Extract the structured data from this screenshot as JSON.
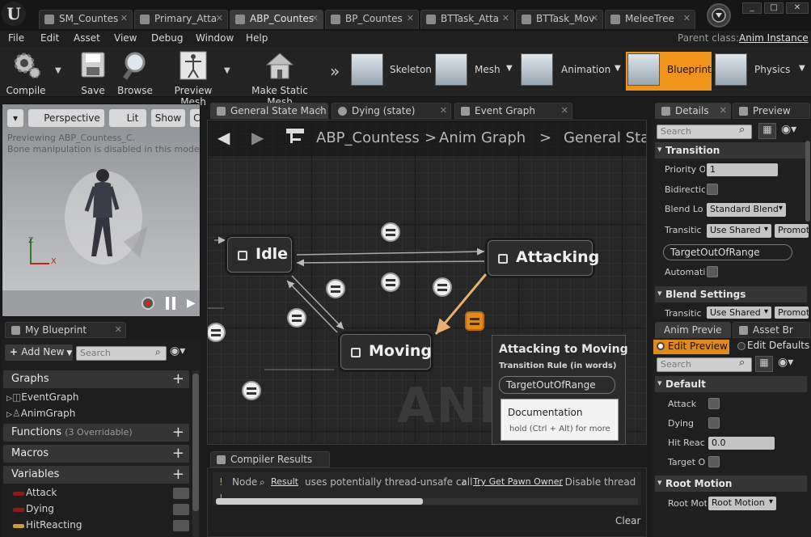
{
  "doc_tabs": [
    {
      "label": "SM_Countes"
    },
    {
      "label": "Primary_Atta"
    },
    {
      "label": "ABP_Countes"
    },
    {
      "label": "BP_Countes"
    },
    {
      "label": "BTTask_Atta"
    },
    {
      "label": "BTTask_Mov"
    },
    {
      "label": "MeleeTree"
    }
  ],
  "menu": [
    "File",
    "Edit",
    "Asset",
    "View",
    "Debug",
    "Window",
    "Help"
  ],
  "parent_class": {
    "label": "Parent class:",
    "value": "Anim Instance"
  },
  "toolbar": {
    "compile": "Compile",
    "save": "Save",
    "browse": "Browse",
    "preview_mesh": "Preview Mesh",
    "make_static_mesh": "Make Static Mesh"
  },
  "modes": {
    "skeleton": "Skeleton",
    "mesh": "Mesh",
    "animation": "Animation",
    "blueprint": "Blueprint",
    "physics": "Physics"
  },
  "viewport": {
    "perspective": "Perspective",
    "lit": "Lit",
    "show": "Show",
    "cl": "Cl",
    "line1": "Previewing ABP_Countess_C.",
    "line2": "Bone manipulation is disabled in this mode.",
    "axis_z": "Z",
    "axis_x": "X"
  },
  "my_blueprint": {
    "tab": "My Blueprint",
    "add_new": "Add New",
    "search_placeholder": "Search",
    "graphs_label": "Graphs",
    "graphs": [
      "EventGraph",
      "AnimGraph"
    ],
    "functions_label": "Functions",
    "functions_count": "(3 Overridable)",
    "macros_label": "Macros",
    "variables_label": "Variables",
    "variables": [
      {
        "name": "Attack",
        "color": "#8a1c1c"
      },
      {
        "name": "Dying",
        "color": "#8a1c1c"
      },
      {
        "name": "HitReacting",
        "color": "#c8a040"
      }
    ]
  },
  "graph_tabs": {
    "state_machine": "General State Mach",
    "dying": "Dying (state)",
    "event_graph": "Event Graph"
  },
  "breadcrumb": {
    "root": "ABP_Countess",
    "sep": ">",
    "middle": "Anim Graph",
    "sep2": ">",
    "last": "General State"
  },
  "watermark": "ANIM",
  "nodes": {
    "idle": "Idle",
    "attacking": "Attacking",
    "moving": "Moving"
  },
  "tooltip": {
    "title": "Attacking to Moving",
    "subtitle": "Transition Rule (in words)",
    "rule": "TargetOutOfRange",
    "doc_title": "Documentation",
    "doc_hint": "hold (Ctrl + Alt) for more"
  },
  "compiler": {
    "tab": "Compiler Results",
    "warn_pre": "Node",
    "link1": "Result",
    "warn_mid": "uses potentially thread-unsafe call",
    "link2": "Try Get Pawn Owner",
    "warn_post": ". Disable thread",
    "clear": "Clear"
  },
  "details": {
    "tab": "Details",
    "preview_tab": "Preview",
    "search_placeholder": "Search",
    "transition_header": "Transition",
    "priority_label": "Priority O",
    "priority_value": "1",
    "bidirectional_label": "Bidirectic",
    "blend_logic_label": "Blend Lo",
    "blend_logic_value": "Standard Blend",
    "transition_rule_label": "Transitic",
    "use_shared": "Use Shared",
    "promote": "Promot",
    "rule_value": "TargetOutOfRange",
    "automatic_label": "Automati",
    "blend_settings_header": "Blend Settings",
    "bs_transition_label": "Transitic",
    "bs_use_shared": "Use Shared",
    "bs_promote": "Promot"
  },
  "anim_preview": {
    "tab": "Anim Previe",
    "asset_tab": "Asset Br",
    "edit_preview": "Edit Preview",
    "edit_defaults": "Edit Defaults",
    "search_placeholder": "Search",
    "default_header": "Default",
    "attack_label": "Attack",
    "dying_label": "Dying",
    "hit_label": "Hit Reac",
    "hit_value": "0.0",
    "target_label": "Target O",
    "root_motion_header": "Root Motion",
    "root_mot_label": "Root Mot",
    "root_mot_value": "Root Motion"
  },
  "colors": {
    "accent_orange": "#e08a1a",
    "blueprint_mode": "#f0941c"
  }
}
